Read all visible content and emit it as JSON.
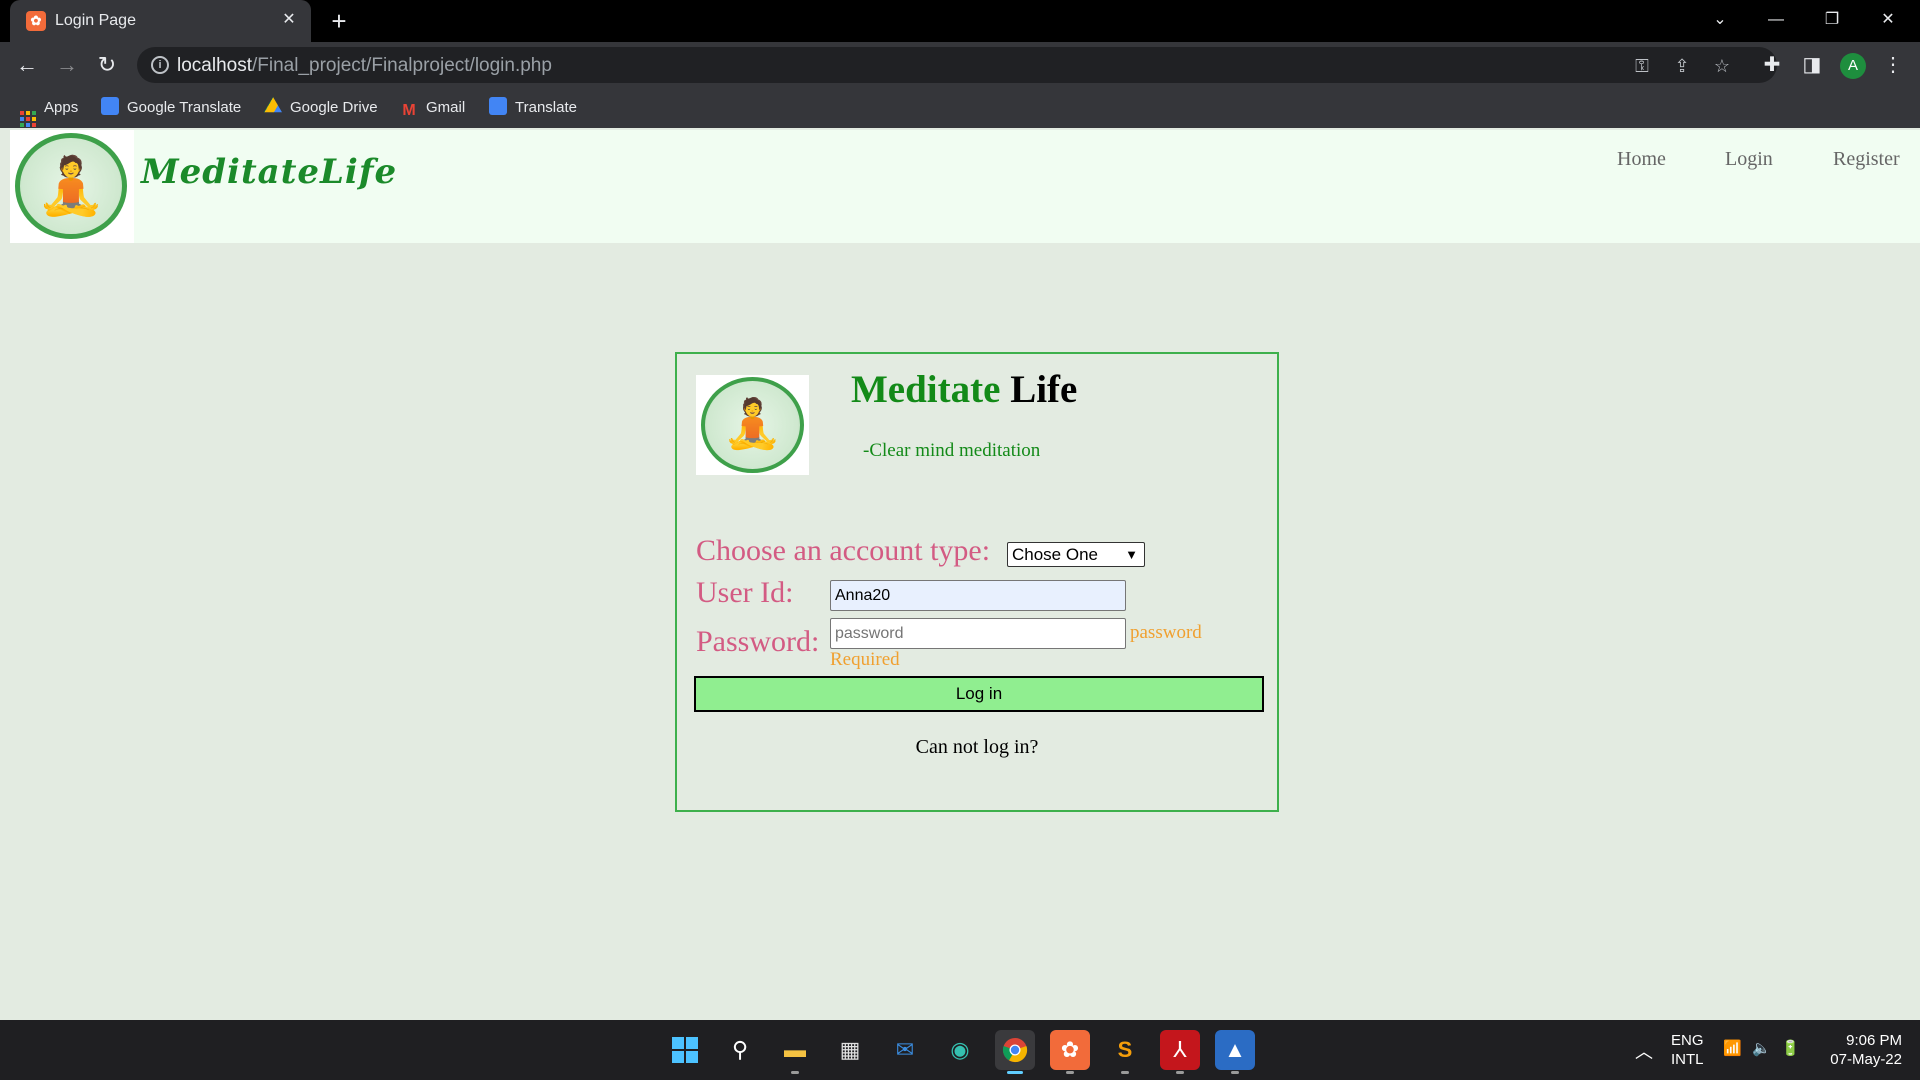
{
  "browser": {
    "tab_title": "Login Page",
    "tab_close": "✕",
    "new_tab": "+",
    "url_host": "localhost",
    "url_path": "/Final_project/Finalproject/login.php",
    "avatar_letter": "A",
    "bookmarks": [
      {
        "label": "Apps",
        "icon": "apps-grid-icon"
      },
      {
        "label": "Google Translate",
        "icon": "google-translate-icon"
      },
      {
        "label": "Google Drive",
        "icon": "google-drive-icon"
      },
      {
        "label": "Gmail",
        "icon": "gmail-icon"
      },
      {
        "label": "Translate",
        "icon": "translate-icon"
      }
    ]
  },
  "site": {
    "brand": "MeditateLife",
    "nav": [
      "Home",
      "Login",
      "Register"
    ]
  },
  "card": {
    "title_part1": "Meditate",
    "title_part2": "Life",
    "tagline": "-Clear mind meditation",
    "account_label": "Choose an account type:",
    "account_select_value": "Chose One",
    "userid_label": "User Id:",
    "userid_value": "Anna20",
    "password_label": "Password:",
    "password_placeholder": "password",
    "password_error_line1": "password",
    "password_error_line2": "Required",
    "login_button": "Log in",
    "cant_login": "Can not log in?"
  },
  "taskbar": {
    "language_line1": "ENG",
    "language_line2": "INTL",
    "time": "9:06 PM",
    "date": "07-May-22",
    "apps": [
      "start-icon",
      "search-icon",
      "file-explorer-icon",
      "microsoft-store-icon",
      "mail-icon",
      "edge-icon",
      "chrome-icon",
      "xampp-icon",
      "sublime-text-icon",
      "acrobat-icon",
      "photos-icon"
    ]
  },
  "colors": {
    "page_bg": "#e3ebe1",
    "brand_green": "#1b8a2a",
    "label_pink": "#d35b83",
    "error_orange": "#f0a030",
    "button_green": "#90ee90"
  }
}
